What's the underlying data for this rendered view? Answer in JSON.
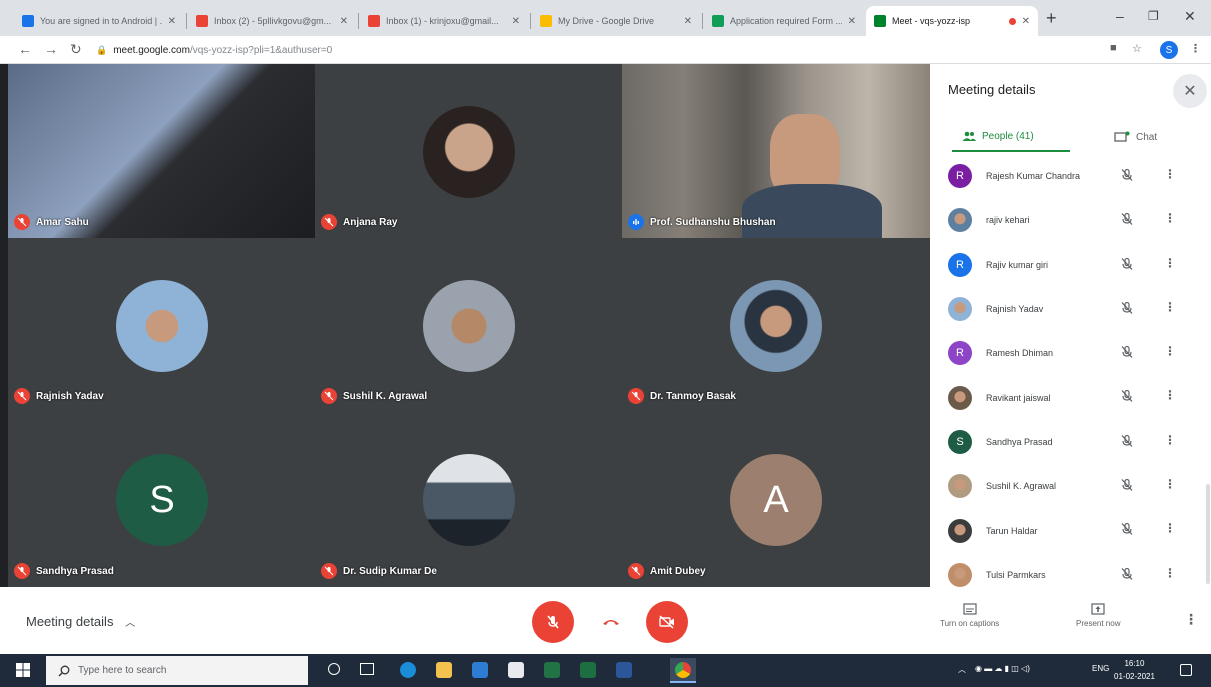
{
  "browser": {
    "tabs": [
      {
        "title": "You are signed in to Android | ...",
        "favicon_color": "#1a73e8"
      },
      {
        "title": "Inbox (2) - 5pllivkgovu@gm...",
        "favicon_color": "#ea4335"
      },
      {
        "title": "Inbox (1) - krinjoxu@gmail...",
        "favicon_color": "#ea4335"
      },
      {
        "title": "My Drive - Google Drive",
        "favicon_color": "#fbbc04"
      },
      {
        "title": "Application required Form ...",
        "favicon_color": "#0f9d58"
      },
      {
        "title": "Meet - vqs-yozz-isp",
        "favicon_color": "#00832d"
      }
    ],
    "url_host": "meet.google.com",
    "url_path": "/vqs-yozz-isp?pli=1&authuser=0",
    "profile_initial": "S"
  },
  "tiles": [
    {
      "name": "Amar Sahu",
      "kind": "video-sky",
      "muted": true
    },
    {
      "name": "Anjana Ray",
      "kind": "photo",
      "avatar_color": "#c9a48a",
      "muted": true
    },
    {
      "name": "Prof. Sudhanshu Bhushan",
      "kind": "video-room",
      "muted": false
    },
    {
      "name": "Rajnish Yadav",
      "kind": "photo",
      "avatar_color": "#8fb3d6",
      "muted": true
    },
    {
      "name": "Sushil K. Agrawal",
      "kind": "photo",
      "avatar_color": "#b09a80",
      "muted": true
    },
    {
      "name": "Dr. Tanmoy Basak",
      "kind": "photo",
      "avatar_color": "#7c97b3",
      "muted": true
    },
    {
      "name": "Sandhya Prasad",
      "kind": "letter",
      "letter": "S",
      "avatar_color": "#1e5c45",
      "muted": true
    },
    {
      "name": "Dr. Sudip Kumar De",
      "kind": "photo",
      "avatar_color": "#4a5866",
      "muted": true
    },
    {
      "name": "Amit Dubey",
      "kind": "letter",
      "letter": "A",
      "avatar_color": "#9c7f6e",
      "muted": true
    }
  ],
  "panel": {
    "title": "Meeting details",
    "people_tab": "People (41)",
    "chat_tab": "Chat",
    "people": [
      {
        "name": "Rajesh Kumar Chandra",
        "avatar": "letter",
        "letter": "R",
        "color": "#7b1fa2"
      },
      {
        "name": "rajiv kehari",
        "avatar": "photo",
        "color": "#5d7fa0"
      },
      {
        "name": "Rajiv kumar giri",
        "avatar": "letter",
        "letter": "R",
        "color": "#1a73e8"
      },
      {
        "name": "Rajnish Yadav",
        "avatar": "photo",
        "color": "#8fb3d6"
      },
      {
        "name": "Ramesh Dhiman",
        "avatar": "letter",
        "letter": "R",
        "color": "#8e44c6"
      },
      {
        "name": "Ravikant jaiswal",
        "avatar": "photo",
        "color": "#6b5a4a"
      },
      {
        "name": "Sandhya Prasad",
        "avatar": "letter",
        "letter": "S",
        "color": "#1e5c45"
      },
      {
        "name": "Sushil K. Agrawal",
        "avatar": "photo",
        "color": "#b09a80"
      },
      {
        "name": "Tarun Haldar",
        "avatar": "photo",
        "color": "#3c3c3c"
      },
      {
        "name": "Tulsi Parmkars",
        "avatar": "photo",
        "color": "#c08f6a"
      }
    ]
  },
  "bottom": {
    "meeting_details": "Meeting details",
    "captions_label": "Turn on captions",
    "present_label": "Present now"
  },
  "taskbar": {
    "search_placeholder": "Type here to search",
    "lang": "ENG",
    "time": "16:10",
    "date": "01-02-2021"
  }
}
